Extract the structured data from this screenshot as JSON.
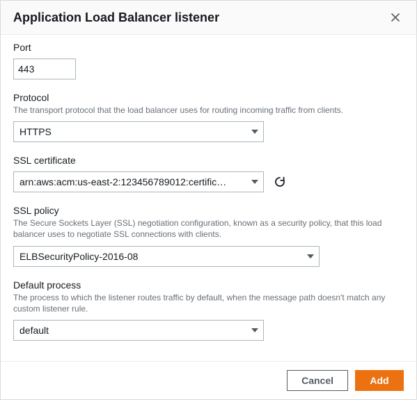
{
  "header": {
    "title": "Application Load Balancer listener"
  },
  "port": {
    "label": "Port",
    "value": "443"
  },
  "protocol": {
    "label": "Protocol",
    "hint": "The transport protocol that the load balancer uses for routing incoming traffic from clients.",
    "value": "HTTPS"
  },
  "ssl_certificate": {
    "label": "SSL certificate",
    "value": "arn:aws:acm:us-east-2:123456789012:certific…"
  },
  "ssl_policy": {
    "label": "SSL policy",
    "hint": "The Secure Sockets Layer (SSL) negotiation configuration, known as a security policy, that this load balancer uses to negotiate SSL connections with clients.",
    "value": "ELBSecurityPolicy-2016-08"
  },
  "default_process": {
    "label": "Default process",
    "hint": "The process to which the listener routes traffic by default, when the message path doesn't match any custom listener rule.",
    "value": "default"
  },
  "footer": {
    "cancel": "Cancel",
    "add": "Add"
  }
}
